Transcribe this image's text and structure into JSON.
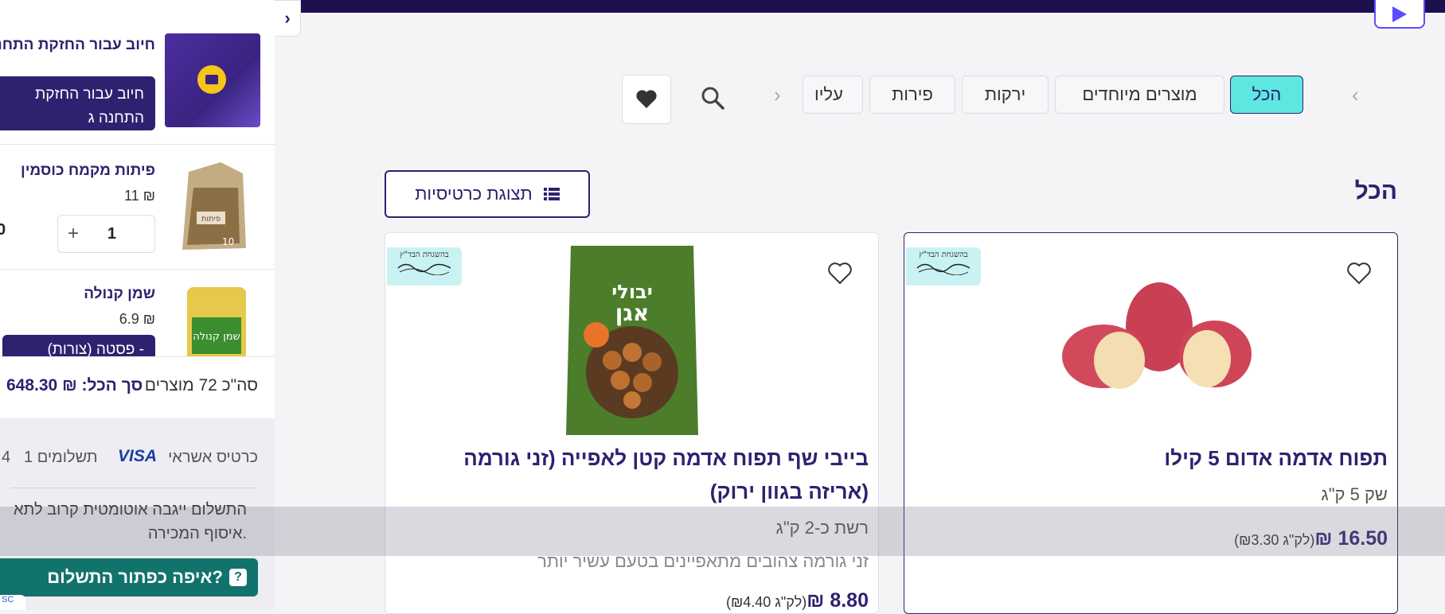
{
  "sidebar": {
    "items": [
      {
        "title": "חיוב עבור החזקת התחנה ג",
        "button_label": "חיוב עבור החזקת התחנה ג"
      },
      {
        "title": "פיתות מקמח כוסמין",
        "price": "11 ₪",
        "qty": "1",
        "qty_plus": "+",
        "image_label": "פיתות",
        "image_number": "10"
      },
      {
        "title": "שמן קנולה",
        "price": "6.9 ₪",
        "button_label": "פסטה (צורות) -",
        "image_label": "שמן קנולה"
      }
    ],
    "summary": {
      "count_text": "סה\"כ 72 מוצרים",
      "total_label": "סך הכל:",
      "total_value": "₪ 648.30"
    },
    "payment": {
      "method_label": "כרטיס אשראי",
      "card_brand": "VISA",
      "installments": "1 תשלומים",
      "installments_cut": "4",
      "note_line1": "התשלום ייגבה אוטומטית קרוב לתא",
      "note_line2": "איסוף המכירה.",
      "help_label": "איפה כפתור התשלום?",
      "help_icon": "?"
    },
    "corner_badge": "SC"
  },
  "categories": {
    "items": [
      "הכל",
      "מוצרים מיוחדים",
      "ירקות",
      "פירות",
      "עליו"
    ],
    "active": "הכל"
  },
  "section_title": "הכל",
  "view_toggle_label": "תצוגת כרטיסיות",
  "kosher_text": "בהשגחת הבד\"ץ",
  "products": [
    {
      "title": "תפוח אדמה אדום 5 קילו",
      "subtitle": "שק 5 ק\"ג",
      "price": "₪ 16.50",
      "unit_price": "(₪3.30 לק\"ג)"
    },
    {
      "title_line1": "בייבי שף תפוח אדמה קטן לאפייה (זני גורמה",
      "title_line2": "(אריזה בגוון ירוק)",
      "subtitle": "רשת כ-2 ק\"ג",
      "description": "זני גורמה צהובים מתאפיינים בטעם עשיר יותר",
      "price": "₪ 8.80",
      "unit_price": "(₪4.40 לק\"ג)",
      "brand_line1": "יבולי",
      "brand_line2": "אגן"
    }
  ],
  "colors": {
    "primary": "#2d2270",
    "active_chip": "#5ee6e0",
    "topbar": "#1e0f4e",
    "help": "#12736d"
  }
}
